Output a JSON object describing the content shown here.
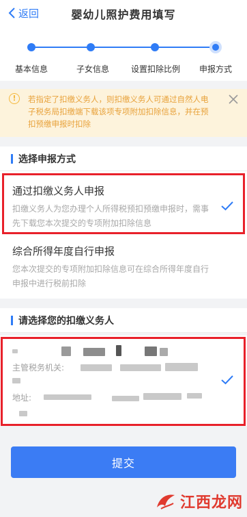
{
  "header": {
    "back_label": "返回",
    "title": "婴幼儿照护费用填写"
  },
  "steps": [
    {
      "label": "基本信息"
    },
    {
      "label": "子女信息"
    },
    {
      "label": "设置扣除比例"
    },
    {
      "label": "申报方式"
    }
  ],
  "notice": {
    "text": "若指定了扣缴义务人，则扣缴义务人可通过自然人电子税务局扣缴端下载该项专项附加扣除信息，并在预扣预缴申报时扣除"
  },
  "method_section": {
    "title": "选择申报方式",
    "options": [
      {
        "title": "通过扣缴义务人申报",
        "desc": "扣缴义务人为您办理个人所得税预扣预缴申报时，需事先下载您本次提交的专项附加扣除信息",
        "selected": true
      },
      {
        "title": "综合所得年度自行申报",
        "desc": "您本次提交的专项附加扣除信息可在综合所得年度自行申报中进行税前扣除",
        "selected": false
      }
    ]
  },
  "payer_section": {
    "title": "请选择您的扣缴义务人",
    "tax_office_label": "主管税务机关:",
    "address_label": "地址:"
  },
  "submit_label": "提交",
  "watermark": {
    "text": "江西龙网"
  },
  "colors": {
    "accent": "#2f7cf6",
    "notice_bg": "#fdf3dc",
    "notice_text": "#e8a23b",
    "highlight_border": "#e8202a"
  }
}
